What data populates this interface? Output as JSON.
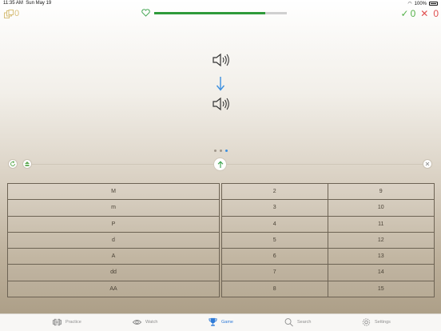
{
  "status": {
    "time": "11:35 AM",
    "date": "Sun May 19",
    "battery": "100%"
  },
  "coins": {
    "count": "0"
  },
  "health": {
    "fill_fraction": 0.84
  },
  "score": {
    "correct": "0",
    "wrong": "0"
  },
  "pager": {
    "pages": 3,
    "active": 3
  },
  "answers": {
    "left": [
      "M",
      "m",
      "P",
      "d",
      "A",
      "dd",
      "AA"
    ],
    "right_a": [
      "2",
      "3",
      "4",
      "5",
      "6",
      "7",
      "8"
    ],
    "right_b": [
      "9",
      "10",
      "11",
      "12",
      "13",
      "14",
      "15"
    ]
  },
  "tabs": [
    {
      "label": "Practice",
      "icon": "dumbbell-icon"
    },
    {
      "label": "Watch",
      "icon": "eye-icon"
    },
    {
      "label": "Game",
      "icon": "trophy-icon"
    },
    {
      "label": "Search",
      "icon": "search-icon"
    },
    {
      "label": "Settings",
      "icon": "gear-icon"
    }
  ],
  "colors": {
    "accent": "#2f7bd8",
    "health": "#2f9a3a",
    "correct": "#55b24a",
    "wrong": "#e05050",
    "coins": "#d7bf7a"
  }
}
